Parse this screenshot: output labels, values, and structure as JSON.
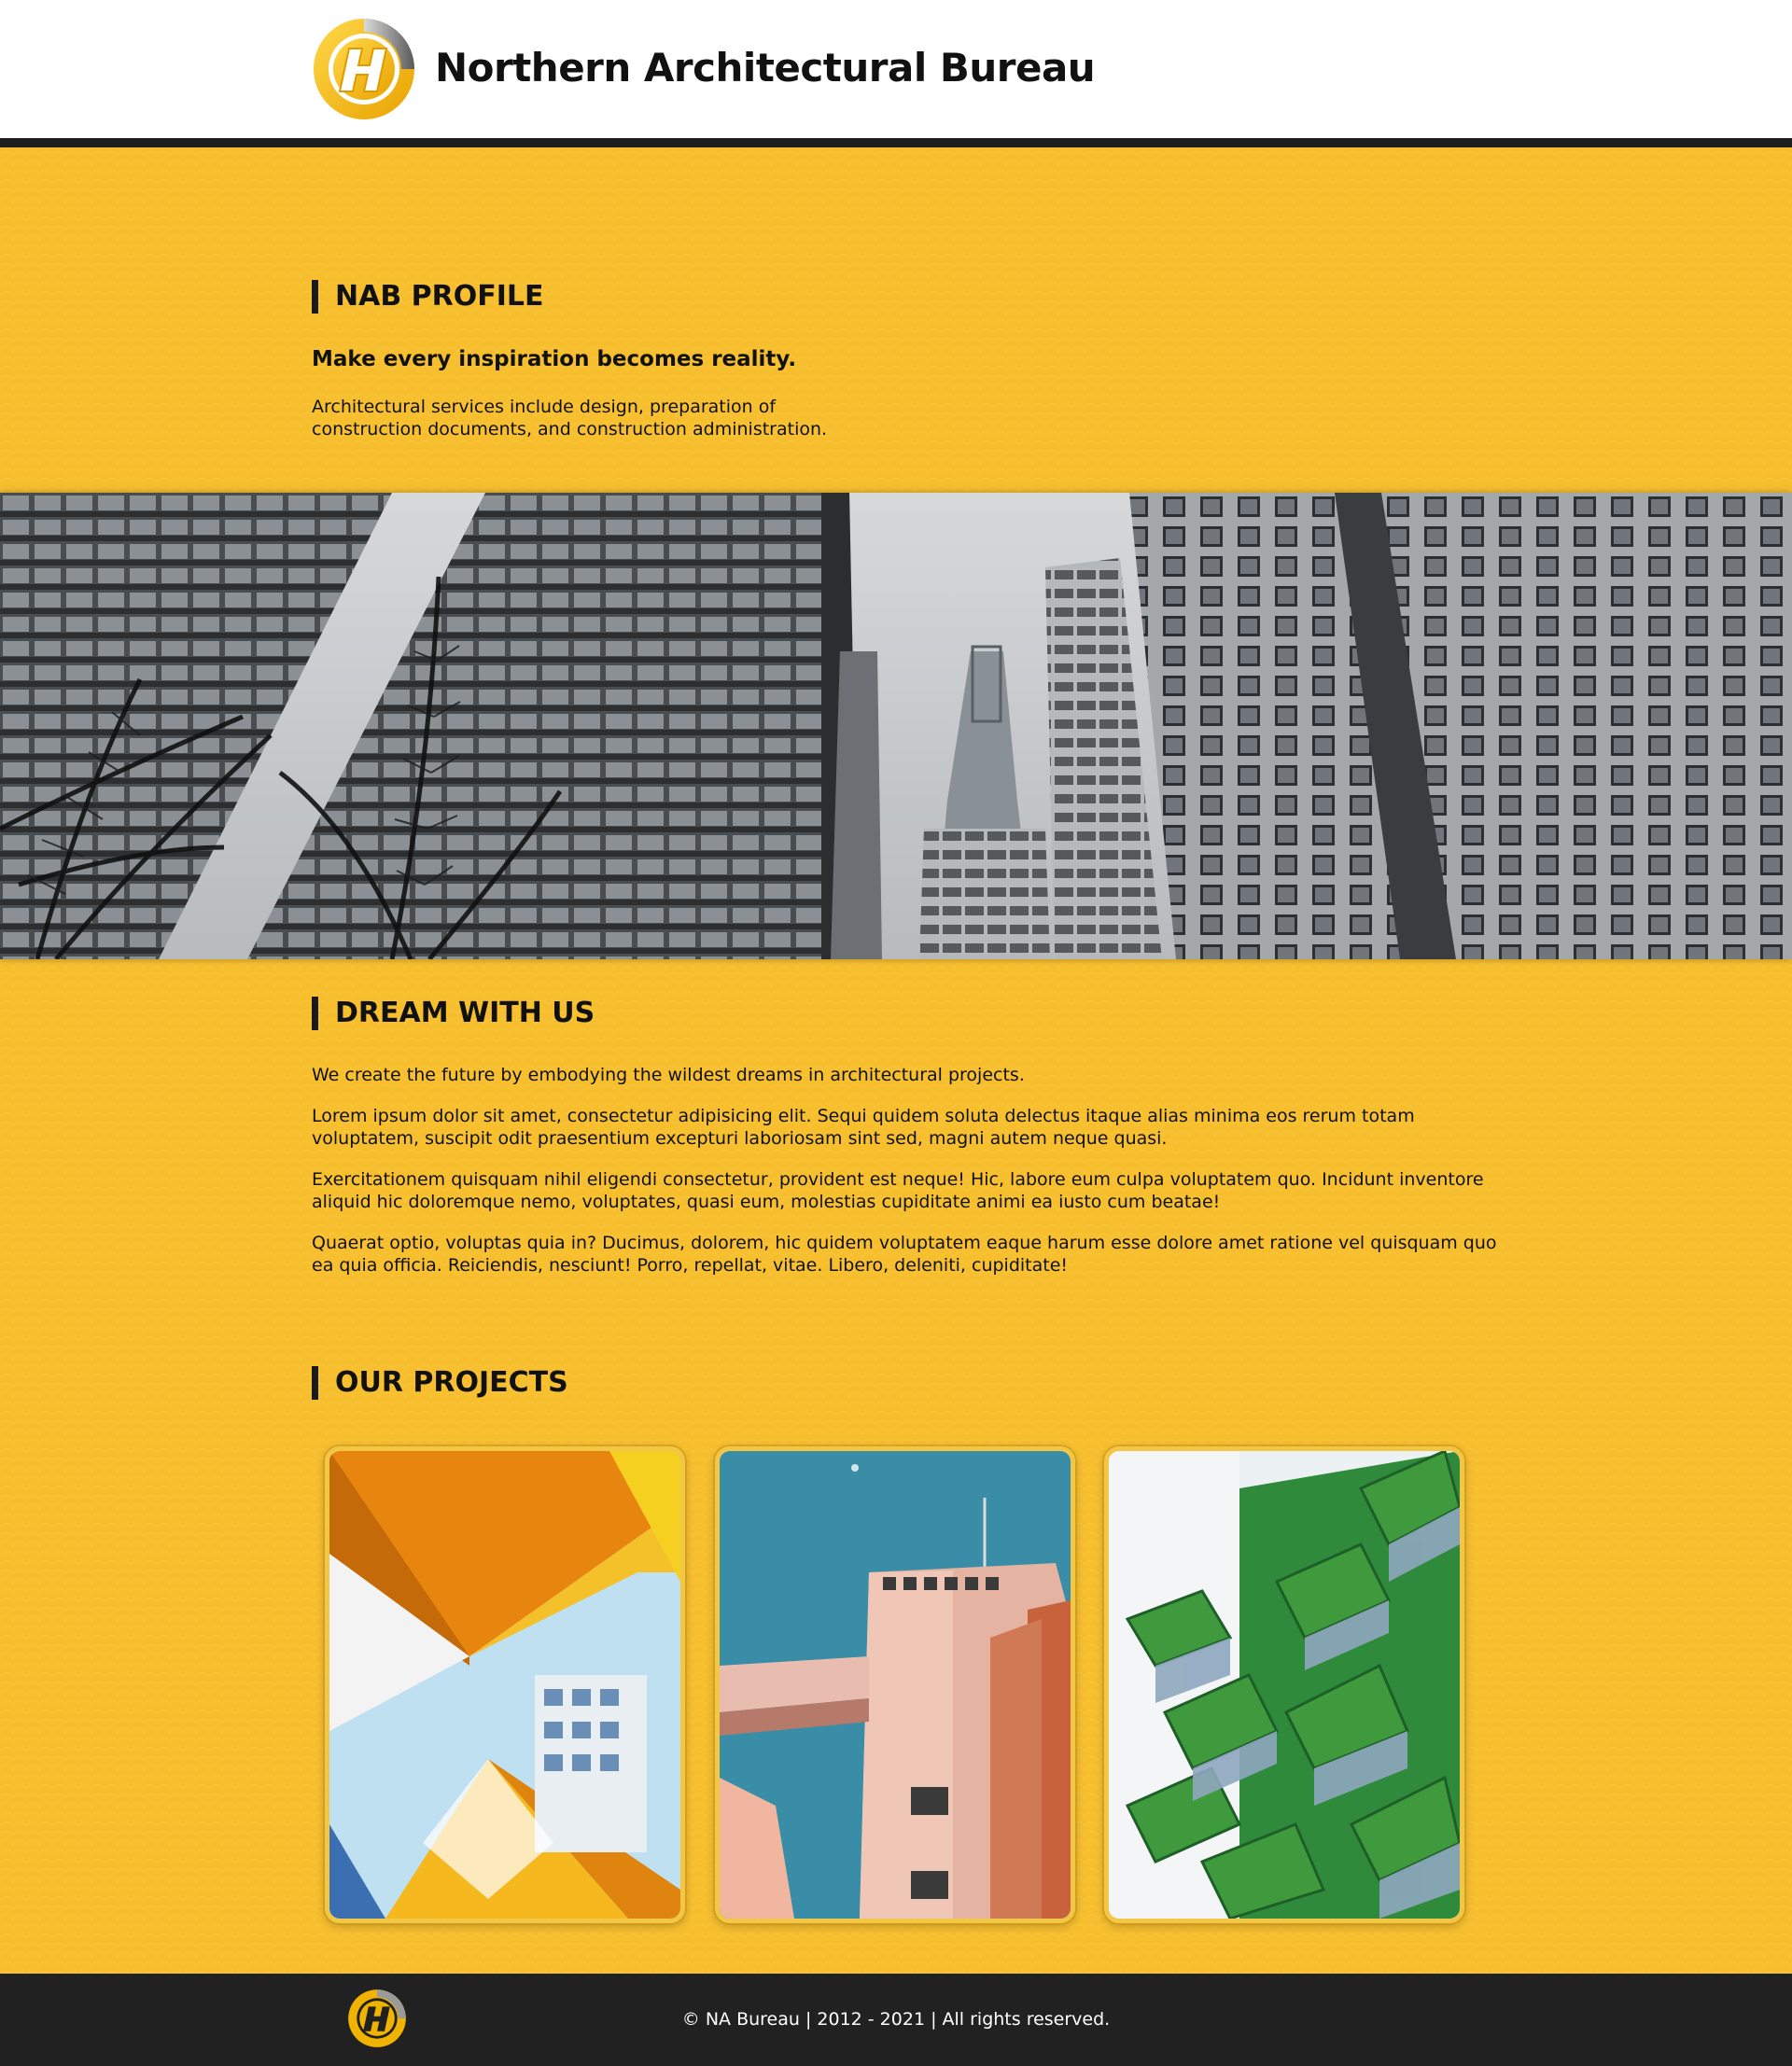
{
  "header": {
    "site_title": "Northern Architectural Bureau",
    "logo_icon": "nab-logo-icon"
  },
  "profile": {
    "heading": "NAB PROFILE",
    "tagline": "Make every inspiration becomes reality.",
    "description": "Architectural services include design, preparation of construction documents, and construction administration."
  },
  "hero": {
    "image": "skyscrapers-photo"
  },
  "dream": {
    "heading": "DREAM WITH US",
    "paragraphs": [
      "We create the future by embodying the wildest dreams in architectural projects.",
      "Lorem ipsum dolor sit amet, consectetur adipisicing elit. Sequi quidem soluta delectus itaque alias minima eos rerum totam voluptatem, suscipit odit praesentium excepturi laboriosam sint sed, magni autem neque quasi.",
      "Exercitationem quisquam nihil eligendi consectetur, provident est neque! Hic, labore eum culpa voluptatem quo. Incidunt inventore aliquid hic doloremque nemo, voluptates, quasi eum, molestias cupiditate animi ea iusto cum beatae!",
      "Quaerat optio, voluptas quia in? Ducimus, dolorem, hic quidem voluptatem eaque harum esse dolore amet ratione vel quisquam quo ea quia officia. Reiciendis, nesciunt! Porro, repellat, vitae. Libero, deleniti, cupiditate!"
    ]
  },
  "projects": {
    "heading": "OUR PROJECTS",
    "items": [
      {
        "image": "cube-houses-photo"
      },
      {
        "image": "pink-tower-photo"
      },
      {
        "image": "green-balconies-photo"
      }
    ]
  },
  "footer": {
    "copyright": "© NA Bureau | 2012 - 2021 | All rights reserved."
  },
  "colors": {
    "accent_yellow": "#f7bf2e",
    "header_bg": "#ffffff",
    "footer_bg": "#212121",
    "rule": "#1e1e1e"
  }
}
